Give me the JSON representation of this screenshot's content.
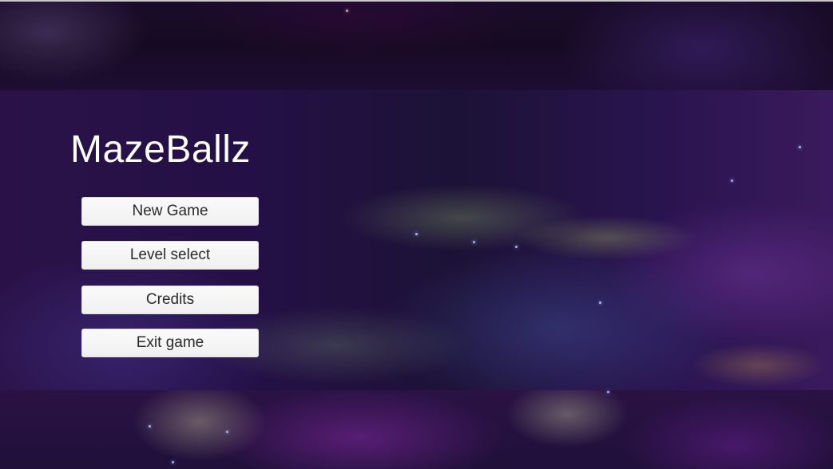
{
  "game": {
    "title": "MazeBallz"
  },
  "main_menu": {
    "buttons": [
      {
        "label": "New Game"
      },
      {
        "label": "Level select"
      },
      {
        "label": "Credits"
      },
      {
        "label": "Exit game"
      }
    ]
  },
  "colors": {
    "button_background": "#f5f5f5",
    "button_text": "#2a2a2a",
    "title_text": "#ffffff",
    "background_theme": "#241046"
  }
}
